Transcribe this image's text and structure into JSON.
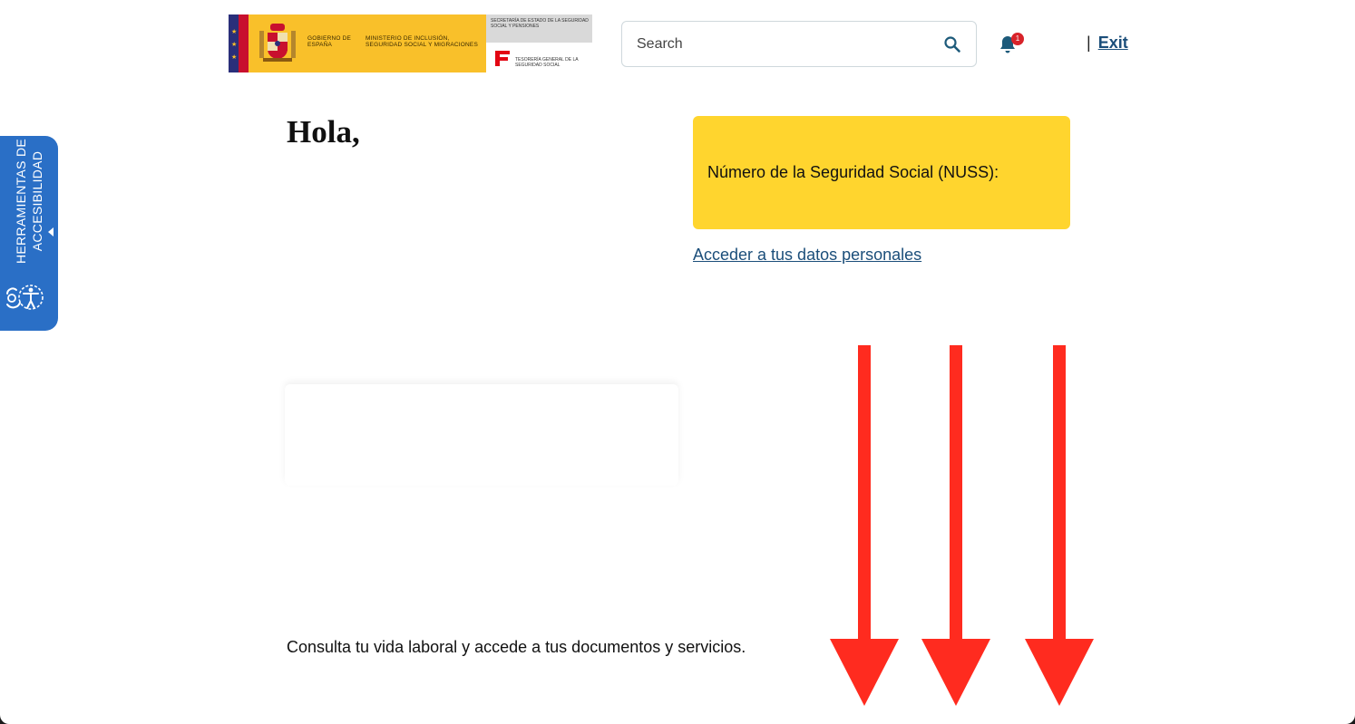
{
  "header": {
    "logo": {
      "gov_line": "GOBIERNO DE ESPAÑA",
      "ministry_line": "MINISTERIO DE INCLUSIÓN, SEGURIDAD SOCIAL Y MIGRACIONES",
      "secretariat_line": "SECRETARÍA DE ESTADO DE LA SEGURIDAD SOCIAL Y PENSIONES",
      "tgss_line": "TESORERÍA GENERAL DE LA SEGURIDAD SOCIAL"
    },
    "search": {
      "placeholder": "Search",
      "value": ""
    },
    "notifications": {
      "count": "1"
    },
    "separator": "|",
    "exit_label": "Exit"
  },
  "accessibility_tab": {
    "label_line1": "HERRAMIENTAS DE",
    "label_line2": "ACCESIBILIDAD"
  },
  "main": {
    "greeting": "Hola,",
    "nuss_label": "Número de la Seguridad Social (NUSS):",
    "personal_data_link": "Acceder a tus datos personales",
    "consult_text": "Consulta tu vida laboral y accede a tus documentos y servicios."
  },
  "colors": {
    "nuss_card": "#ffd52e",
    "link": "#1b4e7a",
    "accessibility_tab": "#2a6fc6",
    "annotation_arrow": "#ff2b1f",
    "notification_badge": "#d8232a"
  }
}
